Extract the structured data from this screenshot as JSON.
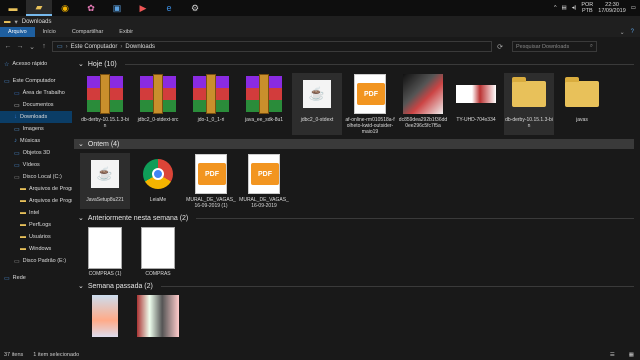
{
  "taskbar": {
    "lang": "POR",
    "lang2": "PTB",
    "time": "22:30",
    "date": "17/09/2019"
  },
  "window": {
    "title": "Downloads"
  },
  "ribbon": {
    "tabs": [
      "Arquivo",
      "Início",
      "Compartilhar",
      "Exibir"
    ]
  },
  "address": {
    "parts": [
      "Este Computador",
      "Downloads"
    ],
    "search_placeholder": "Pesquisar Downloads"
  },
  "nav": [
    {
      "label": "Acesso rápido",
      "color": "#4a90d9"
    },
    {
      "label": "Este Computador",
      "color": "#4a90d9"
    },
    {
      "label": "Área de Trabalho",
      "color": "#3b7dd8"
    },
    {
      "label": "Documentos",
      "color": "#cfcfcf"
    },
    {
      "label": "Downloads",
      "color": "#3b7dd8"
    },
    {
      "label": "Imagens",
      "color": "#5aa0e0"
    },
    {
      "label": "Músicas",
      "color": "#4a90d9"
    },
    {
      "label": "Objetos 3D",
      "color": "#4a90d9"
    },
    {
      "label": "Vídeos",
      "color": "#4a90d9"
    },
    {
      "label": "Disco Local (C:)",
      "color": "#9a9a9a"
    },
    {
      "label": "Arquivos de Progr",
      "color": "#e8c15a"
    },
    {
      "label": "Arquivos de Progr",
      "color": "#e8c15a"
    },
    {
      "label": "Intel",
      "color": "#e8c15a"
    },
    {
      "label": "PerfLogs",
      "color": "#e8c15a"
    },
    {
      "label": "Usuários",
      "color": "#e8c15a"
    },
    {
      "label": "Windows",
      "color": "#e8c15a"
    },
    {
      "label": "Disco Padrão (E:)",
      "color": "#9a9a9a"
    },
    {
      "label": "Rede",
      "color": "#4a90d9"
    }
  ],
  "groups": [
    {
      "title": "Hoje (10)",
      "items": [
        {
          "label": "db-derby-10.15.1.3-bin",
          "type": "winrar"
        },
        {
          "label": "jdbc2_0-stdext-src",
          "type": "winrar"
        },
        {
          "label": "jdo-1_0_1-ri",
          "type": "winrar"
        },
        {
          "label": "java_ee_sdk-8u1",
          "type": "winrar"
        },
        {
          "label": "jdbc2_0-stdext",
          "type": "java"
        },
        {
          "label": "af-online-rm010518a-folheto-kwid-outsider-maio19",
          "type": "pdf"
        },
        {
          "label": "dc859dea292b1f36dd0ee296c5fc7f5a",
          "type": "photo"
        },
        {
          "label": "TY-UHD-704x334",
          "type": "banner"
        },
        {
          "label": "db-derby-10.15.1.3-bin",
          "type": "folder"
        },
        {
          "label": "javas",
          "type": "folder"
        }
      ]
    },
    {
      "title": "Ontem (4)",
      "items": [
        {
          "label": "JavaSetup8u221",
          "type": "java"
        },
        {
          "label": "LeiaMe",
          "type": "chrome"
        },
        {
          "label": "MURAL_DE_VAGAS_16-09-2019 (1)",
          "type": "pdf"
        },
        {
          "label": "MURAL_DE_VAGAS_16-09-2019",
          "type": "pdf"
        }
      ]
    },
    {
      "title": "Anteriormente nesta semana (2)",
      "items": [
        {
          "label": "COMPRAS (1)",
          "type": "doc"
        },
        {
          "label": "COMPRAS",
          "type": "doc"
        }
      ]
    },
    {
      "title": "Semana passada (2)",
      "items": [
        {
          "label": "",
          "type": "photo2"
        },
        {
          "label": "",
          "type": "photo3"
        }
      ]
    }
  ],
  "status": {
    "count": "37 itens",
    "selected": "1 item selecionado"
  },
  "pdf_tag": "PDF"
}
